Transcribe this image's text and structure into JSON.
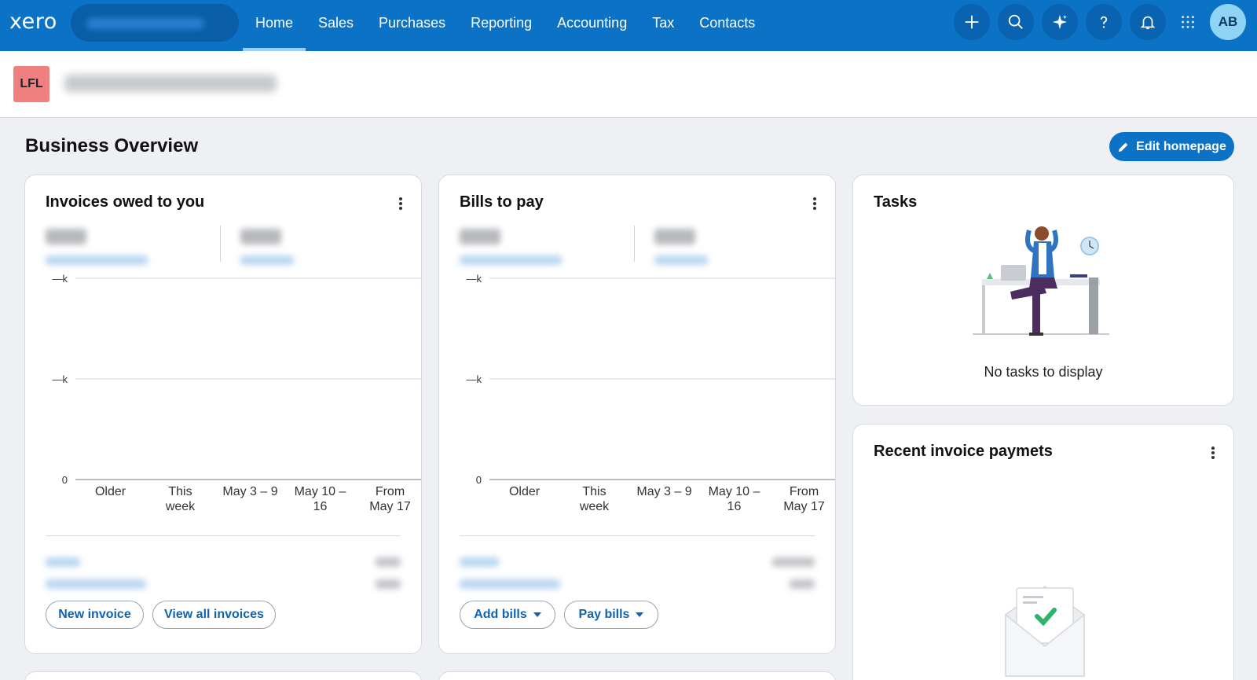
{
  "app": {
    "logo_text": "xero"
  },
  "nav": {
    "tabs": [
      {
        "label": "Home",
        "active": true
      },
      {
        "label": "Sales",
        "active": false
      },
      {
        "label": "Purchases",
        "active": false
      },
      {
        "label": "Reporting",
        "active": false
      },
      {
        "label": "Accounting",
        "active": false
      },
      {
        "label": "Tax",
        "active": false
      },
      {
        "label": "Contacts",
        "active": false
      }
    ],
    "icons": [
      "plus-icon",
      "search-icon",
      "sparkle-icon",
      "help-icon",
      "bell-icon",
      "apps-grid-icon"
    ],
    "avatar_initials": "AB",
    "colors": {
      "bar": "#0c72c6",
      "active_indicator": "#9fcdf3",
      "avatar": "#8fd3f5"
    }
  },
  "org": {
    "badge": "LFL",
    "badge_color": "#f08080"
  },
  "page": {
    "title": "Business Overview",
    "edit_button": "Edit homepage"
  },
  "invoices_card": {
    "title": "Invoices owed to you",
    "chart": {
      "y_ticks": [
        "—k",
        "—k",
        "0"
      ],
      "x_labels": [
        [
          "Older"
        ],
        [
          "This",
          "week"
        ],
        [
          "May 3 – 9"
        ],
        [
          "May 10 –",
          "16"
        ],
        [
          "From",
          "May 17"
        ]
      ]
    },
    "buttons": {
      "primary": "New invoice",
      "secondary": "View all invoices"
    }
  },
  "bills_card": {
    "title": "Bills to pay",
    "chart": {
      "y_ticks": [
        "—k",
        "—k",
        "0"
      ],
      "x_labels": [
        [
          "Older"
        ],
        [
          "This",
          "week"
        ],
        [
          "May 3 – 9"
        ],
        [
          "May 10 –",
          "16"
        ],
        [
          "From",
          "May 17"
        ]
      ]
    },
    "buttons": {
      "add": "Add bills",
      "pay": "Pay bills"
    }
  },
  "tasks_card": {
    "title": "Tasks",
    "empty_text": "No tasks to display"
  },
  "payments_card": {
    "title": "Recent invoice paymets"
  }
}
